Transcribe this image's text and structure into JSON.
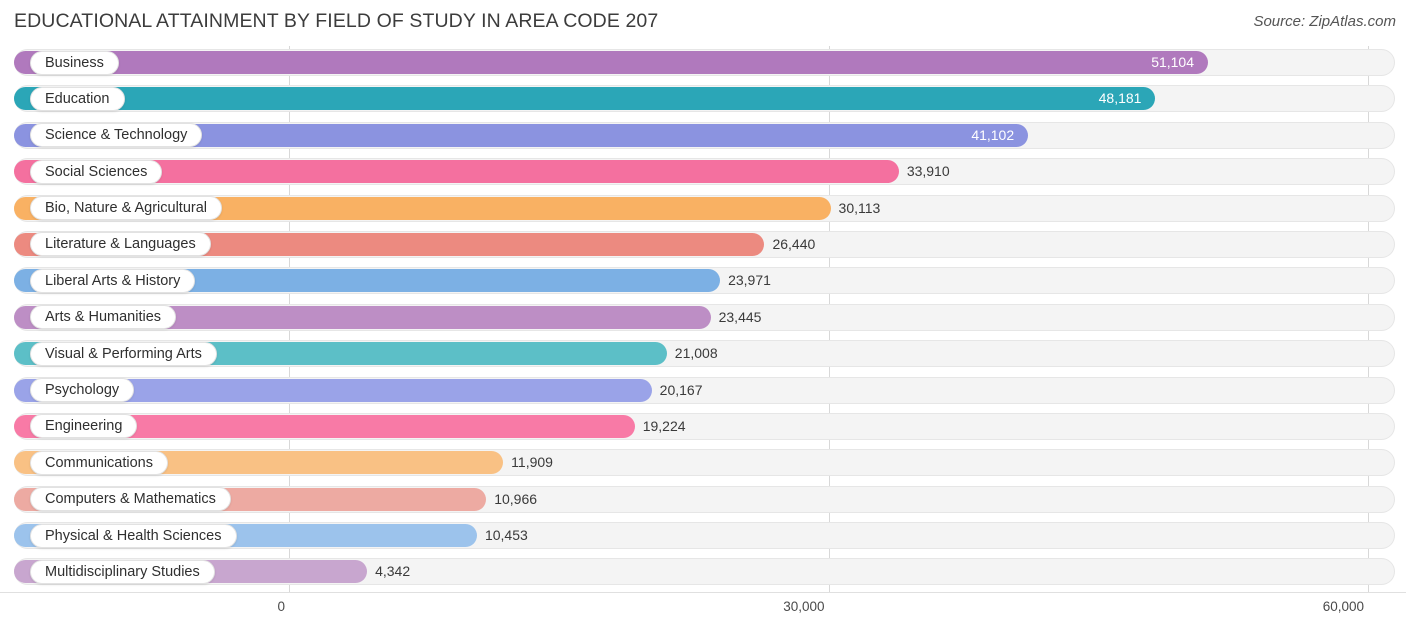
{
  "header": {
    "title": "EDUCATIONAL ATTAINMENT BY FIELD OF STUDY IN AREA CODE 207",
    "source": "Source: ZipAtlas.com"
  },
  "chart_data": {
    "type": "bar",
    "orientation": "horizontal",
    "title": "EDUCATIONAL ATTAINMENT BY FIELD OF STUDY IN AREA CODE 207",
    "xlabel": "",
    "ylabel": "",
    "xlim": [
      0,
      60000
    ],
    "xticks": [
      "0",
      "30,000",
      "60,000"
    ],
    "xtick_values": [
      0,
      30000,
      60000
    ],
    "grid": true,
    "legend": "none",
    "categories": [
      "Business",
      "Education",
      "Science & Technology",
      "Social Sciences",
      "Bio, Nature & Agricultural",
      "Literature & Languages",
      "Liberal Arts & History",
      "Arts & Humanities",
      "Visual & Performing Arts",
      "Psychology",
      "Engineering",
      "Communications",
      "Computers & Mathematics",
      "Physical & Health Sciences",
      "Multidisciplinary Studies"
    ],
    "values": [
      51104,
      48181,
      41102,
      33910,
      30113,
      26440,
      23971,
      23445,
      21008,
      20167,
      19224,
      11909,
      10966,
      10453,
      4342
    ],
    "value_labels": [
      "51,104",
      "48,181",
      "41,102",
      "33,910",
      "30,113",
      "26,440",
      "23,971",
      "23,445",
      "21,008",
      "20,167",
      "19,224",
      "11,909",
      "10,966",
      "10,453",
      "4,342"
    ],
    "colors": [
      "#b079bd",
      "#2ba6b7",
      "#8b93e0",
      "#f4709f",
      "#f9b163",
      "#ec8a80",
      "#7cb0e4",
      "#bd8ec5",
      "#5cbfc7",
      "#9aa3e8",
      "#f87aa6",
      "#f9c184",
      "#edaaa2",
      "#9cc3ec",
      "#c8a6cf"
    ],
    "label_inside": [
      true,
      true,
      true,
      false,
      false,
      false,
      false,
      false,
      false,
      false,
      false,
      false,
      false,
      false,
      false
    ]
  }
}
